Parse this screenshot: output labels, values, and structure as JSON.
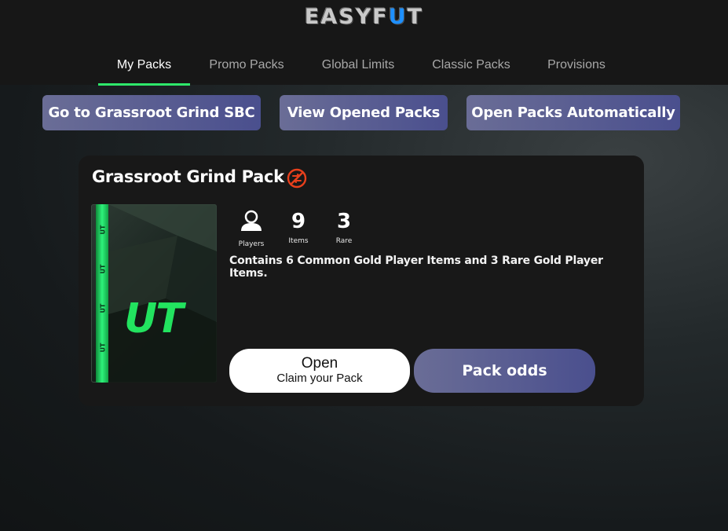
{
  "app": {
    "logo_prefix": "EASYF",
    "logo_accent": "U",
    "logo_suffix": "T",
    "logo_accent_color": "#1e90ff"
  },
  "nav": {
    "tabs": [
      {
        "label": "My Packs",
        "active": true
      },
      {
        "label": "Promo Packs",
        "active": false
      },
      {
        "label": "Global Limits",
        "active": false
      },
      {
        "label": "Classic Packs",
        "active": false
      },
      {
        "label": "Provisions",
        "active": false
      }
    ],
    "active_color": "#2ee86b"
  },
  "actions": {
    "sbc_label": "Go to Grassroot Grind SBC",
    "opened_label": "View Opened Packs",
    "auto_label": "Open Packs Automatically"
  },
  "pack": {
    "title": "Grassroot Grind Pack",
    "untradeable_icon": "untradeable-icon",
    "art_text": "UT",
    "strip_text": "UT",
    "stats": {
      "players_icon": "player-silhouette-icon",
      "players_label": "Players",
      "items_value": "9",
      "items_label": "Items",
      "rare_value": "3",
      "rare_label": "Rare"
    },
    "description": "Contains 6 Common Gold Player Items and 3 Rare Gold Player Items.",
    "open_label": "Open",
    "open_sublabel": "Claim your Pack",
    "odds_label": "Pack odds"
  }
}
